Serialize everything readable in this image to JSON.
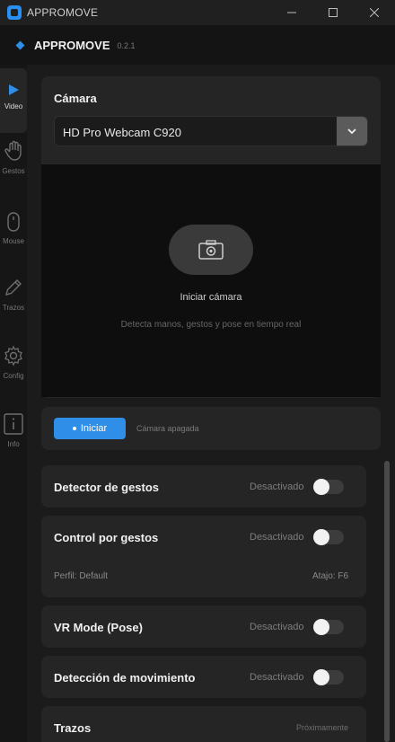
{
  "window": {
    "title": "APPROMOVE",
    "controls": [
      "minimize-icon",
      "maximize-icon",
      "close-icon"
    ]
  },
  "header": {
    "app_name": "APPROMOVE",
    "version": "0.2.1"
  },
  "sidebar": {
    "items": [
      {
        "label": "Video",
        "icon": "play-icon",
        "active": true
      },
      {
        "label": "Gestos",
        "icon": "hand-icon",
        "active": false
      },
      {
        "label": "Mouse",
        "icon": "mouse-icon",
        "active": false
      },
      {
        "label": "Trazos",
        "icon": "pencil-icon",
        "active": false
      },
      {
        "label": "Config",
        "icon": "gear-icon",
        "active": false
      },
      {
        "label": "Info",
        "icon": "info-icon",
        "active": false
      }
    ]
  },
  "camera": {
    "title": "Cámara",
    "selected": "HD Pro Webcam C920",
    "preview_title": "Iniciar cámara",
    "preview_subtitle": "Detecta manos, gestos y pose en tiempo real",
    "start_label": "Iniciar",
    "status": "Cámara apagada"
  },
  "features": {
    "gesture_detector": {
      "label": "Detector de gestos",
      "state": "Desactivado",
      "enabled": false
    },
    "gesture_control": {
      "label": "Control por gestos",
      "state": "Desactivado",
      "enabled": false,
      "profile": "Perfil: Default",
      "shortcut": "Atajo: F6"
    },
    "vr_mode": {
      "label": "VR Mode (Pose)",
      "state": "Desactivado",
      "enabled": false
    },
    "motion_detection": {
      "label": "Detección de movimiento",
      "state": "Desactivado",
      "enabled": false
    },
    "strokes": {
      "label": "Trazos",
      "state": "Próximamente"
    }
  },
  "colors": {
    "accent": "#2f8fe8",
    "background": "#1b1b1b",
    "card": "#252525"
  }
}
